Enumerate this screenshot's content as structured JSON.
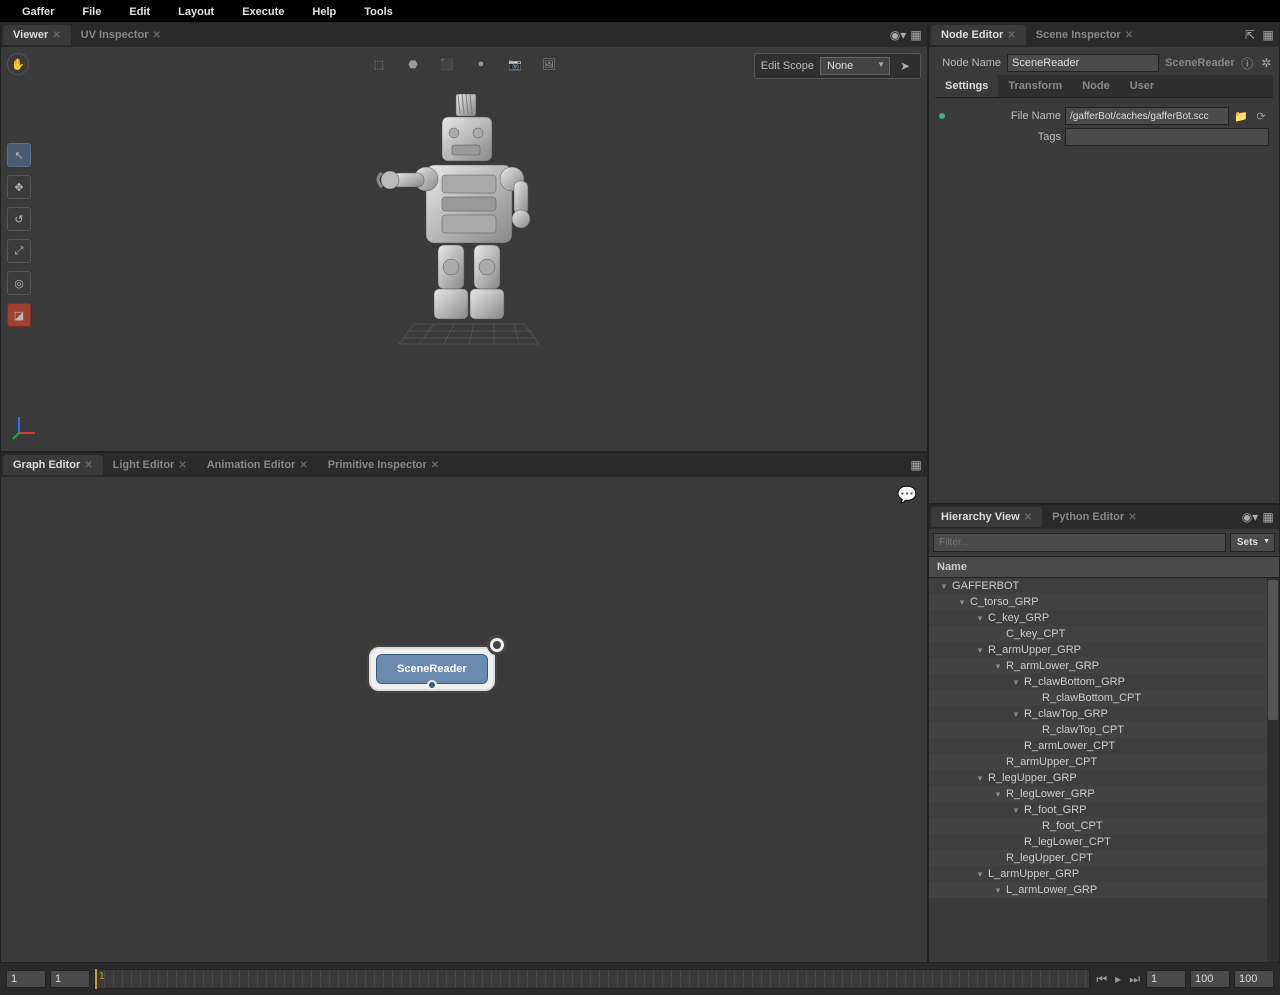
{
  "menu": [
    "Gaffer",
    "File",
    "Edit",
    "Layout",
    "Execute",
    "Help",
    "Tools"
  ],
  "viewer": {
    "tabs": [
      {
        "label": "Viewer",
        "active": true
      },
      {
        "label": "UV Inspector",
        "active": false
      }
    ],
    "editScope": {
      "label": "Edit Scope",
      "value": "None"
    }
  },
  "graph": {
    "tabs": [
      {
        "label": "Graph Editor",
        "active": true
      },
      {
        "label": "Light Editor",
        "active": false
      },
      {
        "label": "Animation Editor",
        "active": false
      },
      {
        "label": "Primitive Inspector",
        "active": false
      }
    ],
    "nodeLabel": "SceneReader"
  },
  "nodeEditor": {
    "tabs": [
      {
        "label": "Node Editor",
        "active": true
      },
      {
        "label": "Scene Inspector",
        "active": false
      }
    ],
    "nodeName": {
      "label": "Node Name",
      "value": "SceneReader"
    },
    "nodeType": "SceneReader",
    "subTabs": [
      "Settings",
      "Transform",
      "Node",
      "User"
    ],
    "activeSubTab": "Settings",
    "fields": {
      "fileName": {
        "label": "File Name",
        "value": "/gafferBot/caches/gafferBot.scc"
      },
      "tags": {
        "label": "Tags",
        "value": ""
      }
    }
  },
  "hierarchy": {
    "tabs": [
      {
        "label": "Hierarchy View",
        "active": true
      },
      {
        "label": "Python Editor",
        "active": false
      }
    ],
    "filterPlaceholder": "Filter...",
    "setsLabel": "Sets",
    "headerLabel": "Name",
    "items": [
      {
        "name": "GAFFERBOT",
        "depth": 0,
        "expanded": true
      },
      {
        "name": "C_torso_GRP",
        "depth": 1,
        "expanded": true
      },
      {
        "name": "C_key_GRP",
        "depth": 2,
        "expanded": true
      },
      {
        "name": "C_key_CPT",
        "depth": 3,
        "expanded": false
      },
      {
        "name": "R_armUpper_GRP",
        "depth": 2,
        "expanded": true
      },
      {
        "name": "R_armLower_GRP",
        "depth": 3,
        "expanded": true
      },
      {
        "name": "R_clawBottom_GRP",
        "depth": 4,
        "expanded": true
      },
      {
        "name": "R_clawBottom_CPT",
        "depth": 5,
        "expanded": false
      },
      {
        "name": "R_clawTop_GRP",
        "depth": 4,
        "expanded": true
      },
      {
        "name": "R_clawTop_CPT",
        "depth": 5,
        "expanded": false
      },
      {
        "name": "R_armLower_CPT",
        "depth": 4,
        "expanded": false
      },
      {
        "name": "R_armUpper_CPT",
        "depth": 3,
        "expanded": false
      },
      {
        "name": "R_legUpper_GRP",
        "depth": 2,
        "expanded": true
      },
      {
        "name": "R_legLower_GRP",
        "depth": 3,
        "expanded": true
      },
      {
        "name": "R_foot_GRP",
        "depth": 4,
        "expanded": true
      },
      {
        "name": "R_foot_CPT",
        "depth": 5,
        "expanded": false
      },
      {
        "name": "R_legLower_CPT",
        "depth": 4,
        "expanded": false
      },
      {
        "name": "R_legUpper_CPT",
        "depth": 3,
        "expanded": false
      },
      {
        "name": "L_armUpper_GRP",
        "depth": 2,
        "expanded": true
      },
      {
        "name": "L_armLower_GRP",
        "depth": 3,
        "expanded": true
      }
    ]
  },
  "timeline": {
    "startRange": "1",
    "start": "1",
    "current": "1",
    "end": "100",
    "endRange": "100"
  }
}
